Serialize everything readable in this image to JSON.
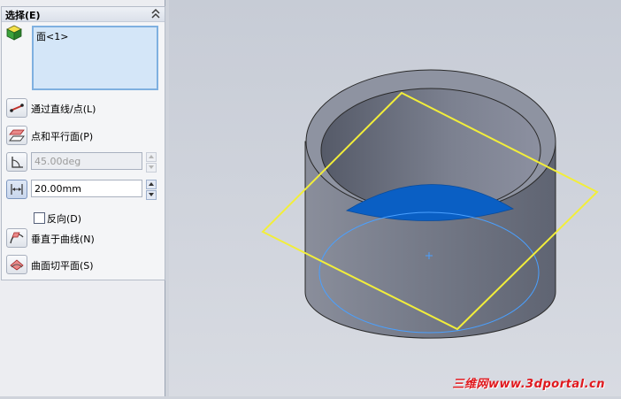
{
  "selection_group": {
    "title": "选择(E)",
    "selected_items": [
      "面<1>"
    ]
  },
  "options": {
    "through_lines_points": "通过直线/点(L)",
    "point_parallel_face": "点和平行面(P)",
    "angle_value": "45.00deg",
    "offset_value": "20.00mm",
    "reverse_label": "反向(D)",
    "reverse_checked": false,
    "normal_to_curve": "垂直于曲线(N)",
    "on_surface": "曲面切平面(S)"
  },
  "watermark": "三维网www.3dportal.cn",
  "colors": {
    "preview_plane": "#f2ee3a",
    "selected_face": "#0a5fc4",
    "body": "#787d8c",
    "selection_list_bg": "#d4e6f8"
  }
}
